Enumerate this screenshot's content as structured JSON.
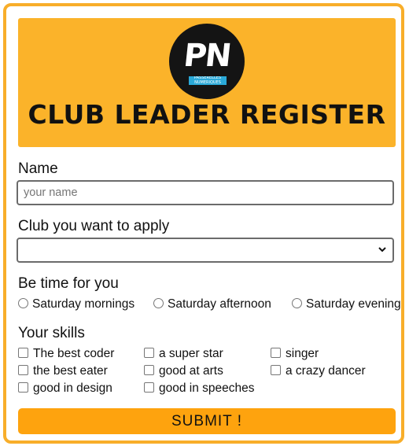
{
  "header": {
    "logo_text": "PN",
    "logo_band_text": "PASSERELLES NUMERIQUES",
    "title": "CLUB LEADER REGISTER"
  },
  "name": {
    "label": "Name",
    "placeholder": "your name",
    "value": ""
  },
  "club": {
    "label": "Club you want to apply",
    "selected": ""
  },
  "time": {
    "label": "Be time for you",
    "options": [
      "Saturday mornings",
      "Saturday afternoon",
      "Saturday evening"
    ]
  },
  "skills": {
    "label": "Your skills",
    "options": [
      "The best coder",
      "a super star",
      "singer",
      "the best eater",
      "good at arts",
      "a crazy dancer",
      "good in design",
      "good in speeches"
    ]
  },
  "submit": {
    "label": "SUBMIT !"
  },
  "colors": {
    "header_bg": "#fbb32a",
    "border": "#f8ae2a",
    "button_bg": "#fea30e"
  }
}
